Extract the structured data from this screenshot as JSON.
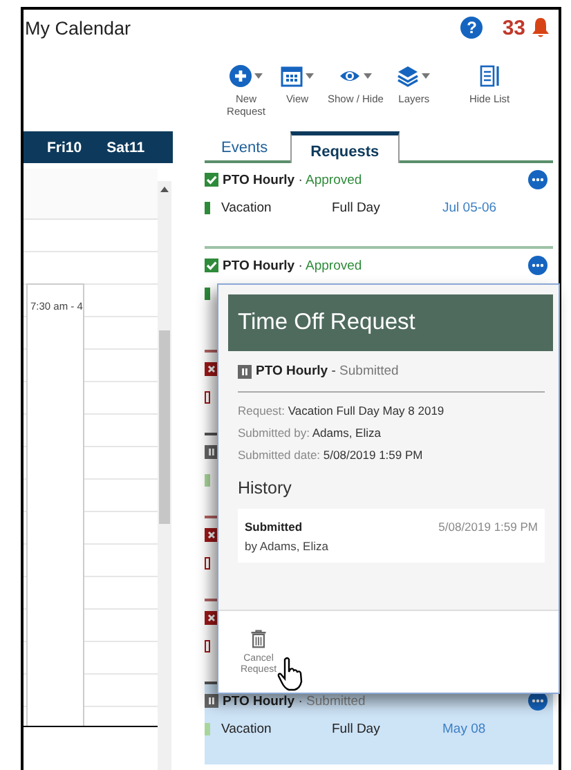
{
  "title": "My Calendar",
  "help": "?",
  "notifications": {
    "count": "33"
  },
  "toolbar": [
    {
      "label": "New Request",
      "dropdown": true
    },
    {
      "label": "View",
      "dropdown": true
    },
    {
      "label": "Show / Hide",
      "dropdown": true
    },
    {
      "label": "Layers",
      "dropdown": true
    },
    {
      "label": "Hide List",
      "dropdown": false
    }
  ],
  "calendar": {
    "days": [
      "Fri10",
      "Sat11"
    ],
    "event": {
      "time": "7:30 am - 4"
    }
  },
  "tabs": [
    {
      "label": "Events",
      "selected": false
    },
    {
      "label": "Requests",
      "selected": true
    }
  ],
  "requests": [
    {
      "kind": "approved",
      "type": "PTO Hourly",
      "separator": "·",
      "state": "Approved",
      "reason": "Vacation",
      "duration": "Full Day",
      "dates": "Jul 05-06",
      "selected": false
    },
    {
      "kind": "approved",
      "type": "PTO Hourly",
      "separator": "·",
      "state": "Approved",
      "selected": false
    },
    {
      "kind": "denied",
      "selected": false
    },
    {
      "kind": "submitted",
      "selected": false
    },
    {
      "kind": "denied",
      "selected": false
    },
    {
      "kind": "denied",
      "selected": false
    },
    {
      "kind": "submitted",
      "type": "PTO Hourly",
      "separator": "·",
      "state": "Submitted",
      "reason": "Vacation",
      "duration": "Full Day",
      "dates": "May 08",
      "selected": true
    }
  ],
  "popup": {
    "title": "Time Off Request",
    "kind": "submitted",
    "type": "PTO Hourly",
    "separator": "-",
    "state": "Submitted",
    "details": [
      {
        "label": "Request:",
        "value": "Vacation Full Day May 8 2019"
      },
      {
        "label": "Submitted by:",
        "value": "Adams, Eliza"
      },
      {
        "label": "Submitted date:",
        "value": "5/08/2019 1:59 PM"
      }
    ],
    "history_title": "History",
    "history": [
      {
        "action": "Submitted",
        "by": "by Adams, Eliza",
        "date": "5/08/2019 1:59 PM"
      }
    ],
    "actions": [
      {
        "label": "Cancel Request"
      }
    ]
  }
}
